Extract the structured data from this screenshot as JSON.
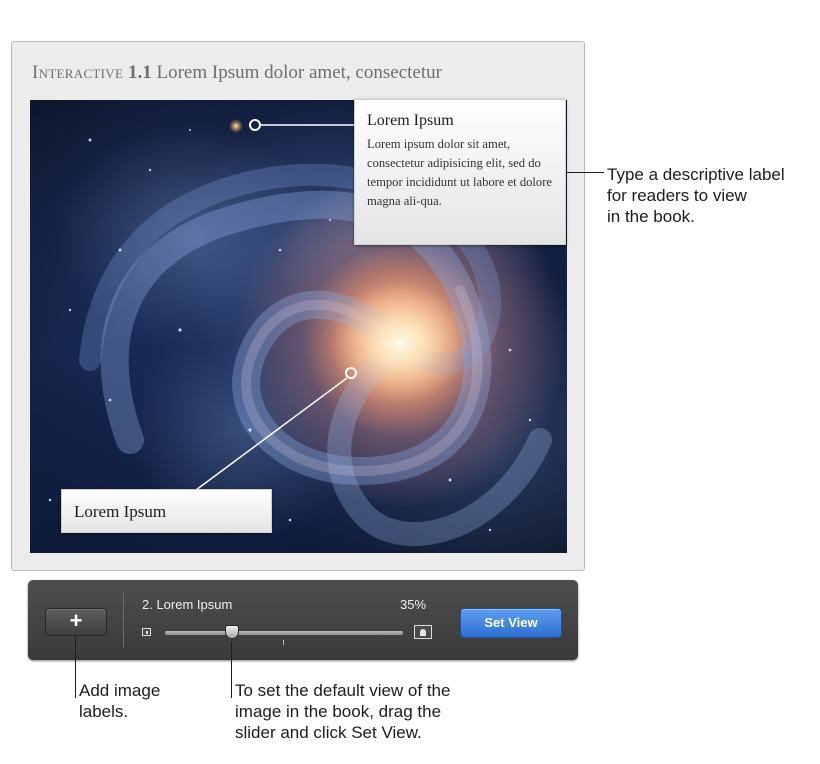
{
  "widget": {
    "title_label": "Interactive",
    "title_number": "1.1",
    "title_text": "Lorem Ipsum dolor amet, consectetur"
  },
  "callouts": {
    "top": {
      "title": "Lorem Ipsum",
      "body": "Lorem ipsum dolor sit amet, consectetur adipisicing elit, sed do tempor incididunt ut labore et dolore magna ali-qua."
    },
    "bottom": {
      "title": "Lorem Ipsum"
    }
  },
  "toolbar": {
    "add_label": "+",
    "current_label": "2. Lorem Ipsum",
    "zoom_percent": "35%",
    "slider_value": 0.28,
    "set_view_label": "Set View"
  },
  "annotations": {
    "right_line1": "Type a descriptive label",
    "right_line2": "for readers to view",
    "right_line3": "in the book.",
    "add_line1": "Add image",
    "add_line2": "labels.",
    "slider_line1": "To set the default view of the",
    "slider_line2": "image in the book, drag the",
    "slider_line3": "slider and click Set View."
  },
  "icons": {
    "zoom_out": "small-image-icon",
    "zoom_in": "large-image-icon",
    "add": "plus-icon"
  },
  "colors": {
    "accent": "#3a7ddc",
    "hud_background": "#444444"
  }
}
